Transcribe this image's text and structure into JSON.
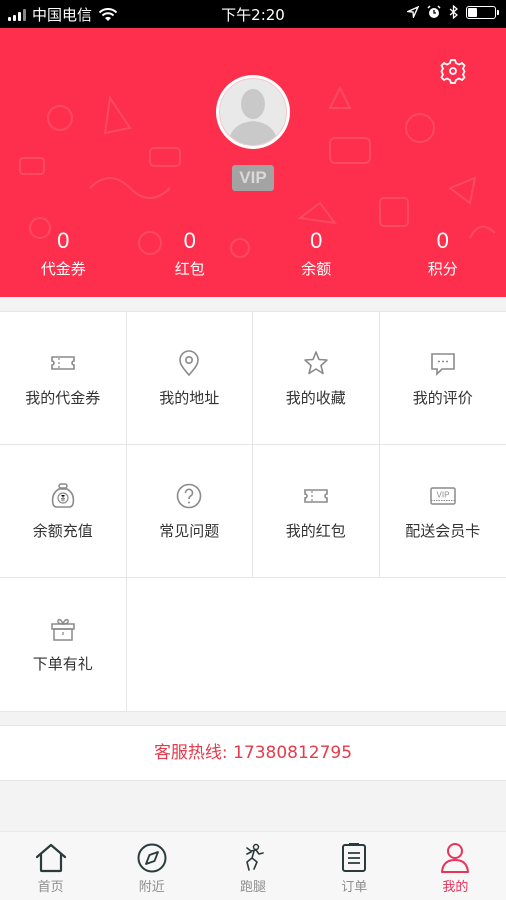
{
  "status_bar": {
    "carrier": "中国电信",
    "time": "下午2:20",
    "battery_level": 0.35
  },
  "header": {
    "vip_label": "VIP",
    "accent_color": "#fd2f4c",
    "stats": [
      {
        "value": "0",
        "label": "代金券"
      },
      {
        "value": "0",
        "label": "红包"
      },
      {
        "value": "0",
        "label": "余额"
      },
      {
        "value": "0",
        "label": "积分"
      }
    ]
  },
  "menu": {
    "items": [
      {
        "label": "我的代金券",
        "icon": "ticket-icon"
      },
      {
        "label": "我的地址",
        "icon": "location-pin-icon"
      },
      {
        "label": "我的收藏",
        "icon": "star-icon"
      },
      {
        "label": "我的评价",
        "icon": "comment-icon"
      },
      {
        "label": "余额充值",
        "icon": "money-bag-icon"
      },
      {
        "label": "常见问题",
        "icon": "question-icon"
      },
      {
        "label": "我的红包",
        "icon": "ticket-icon"
      },
      {
        "label": "配送会员卡",
        "icon": "vip-card-icon"
      },
      {
        "label": "下单有礼",
        "icon": "gift-icon"
      }
    ]
  },
  "hotline": {
    "text": "客服热线: 17380812795",
    "color": "#e53b4b"
  },
  "tabbar": {
    "tabs": [
      {
        "label": "首页",
        "icon": "home-icon",
        "active": false
      },
      {
        "label": "附近",
        "icon": "compass-icon",
        "active": false
      },
      {
        "label": "跑腿",
        "icon": "runner-icon",
        "active": false
      },
      {
        "label": "订单",
        "icon": "order-list-icon",
        "active": false
      },
      {
        "label": "我的",
        "icon": "user-icon",
        "active": true
      }
    ],
    "active_color": "#e8345a"
  }
}
